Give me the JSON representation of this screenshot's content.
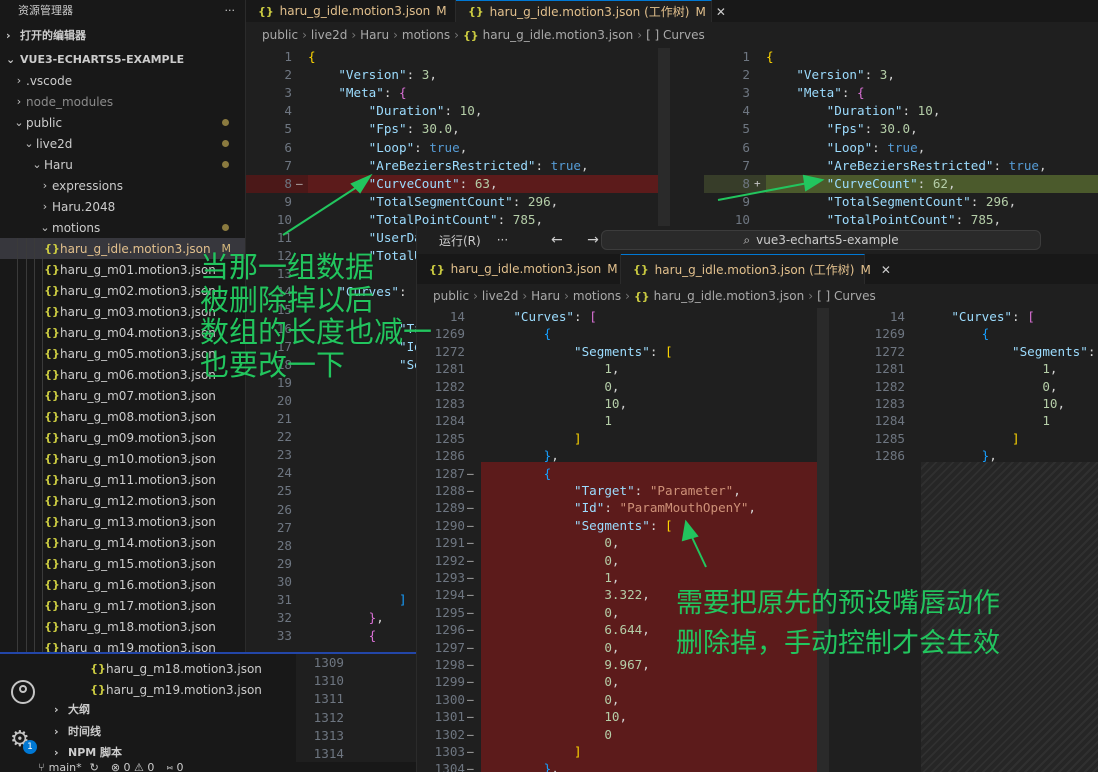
{
  "sidebar": {
    "header": "资源管理器",
    "header_dots": "···",
    "open_editors": "打开的编辑器",
    "project": "VUE3-ECHARTS5-EXAMPLE",
    "items": [
      {
        "label": ".vscode",
        "chev": "›"
      },
      {
        "label": "node_modules",
        "chev": "›"
      },
      {
        "label": "public",
        "chev": "⌄"
      },
      {
        "label": "live2d",
        "chev": "⌄"
      },
      {
        "label": "Haru",
        "chev": "⌄"
      },
      {
        "label": "expressions",
        "chev": "›"
      },
      {
        "label": "Haru.2048",
        "chev": "›"
      },
      {
        "label": "motions",
        "chev": "⌄"
      }
    ],
    "files": [
      "haru_g_idle.motion3.json",
      "haru_g_m01.motion3.json",
      "haru_g_m02.motion3.json",
      "haru_g_m03.motion3.json",
      "haru_g_m04.motion3.json",
      "haru_g_m05.motion3.json",
      "haru_g_m06.motion3.json",
      "haru_g_m07.motion3.json",
      "haru_g_m08.motion3.json",
      "haru_g_m09.motion3.json",
      "haru_g_m10.motion3.json",
      "haru_g_m11.motion3.json",
      "haru_g_m12.motion3.json",
      "haru_g_m13.motion3.json",
      "haru_g_m14.motion3.json",
      "haru_g_m15.motion3.json",
      "haru_g_m16.motion3.json",
      "haru_g_m17.motion3.json",
      "haru_g_m18.motion3.json",
      "haru_g_m19.motion3.json"
    ],
    "modified_flag": "M"
  },
  "editor1": {
    "tab1": "haru_g_idle.motion3.json",
    "tab2": "haru_g_idle.motion3.json (工作树)",
    "flag": "M",
    "close": "✕",
    "breadcrumb": [
      "public",
      "live2d",
      "Haru",
      "motions",
      "haru_g_idle.motion3.json",
      "[ ] Curves"
    ],
    "left_lines": [
      {
        "n": "1"
      },
      {
        "n": "2"
      },
      {
        "n": "3"
      },
      {
        "n": "4"
      },
      {
        "n": "5"
      },
      {
        "n": "6"
      },
      {
        "n": "7"
      },
      {
        "n": "8",
        "mark": "—"
      },
      {
        "n": "9"
      },
      {
        "n": "10"
      },
      {
        "n": "11"
      },
      {
        "n": "12"
      },
      {
        "n": "13"
      },
      {
        "n": "14"
      },
      {
        "n": "15"
      },
      {
        "n": "16"
      },
      {
        "n": "17"
      },
      {
        "n": "18"
      },
      {
        "n": "19"
      },
      {
        "n": "20"
      },
      {
        "n": "21"
      },
      {
        "n": "22"
      },
      {
        "n": "23"
      },
      {
        "n": "24"
      },
      {
        "n": "25"
      },
      {
        "n": "26"
      },
      {
        "n": "27"
      },
      {
        "n": "28"
      },
      {
        "n": "29"
      },
      {
        "n": "30"
      },
      {
        "n": "31"
      },
      {
        "n": "32"
      },
      {
        "n": "33"
      }
    ],
    "code": {
      "version_key": "\"Version\"",
      "version_val": "3",
      "meta_key": "\"Meta\"",
      "duration_key": "\"Duration\"",
      "duration_val": "10",
      "fps_key": "\"Fps\"",
      "fps_val": "30.0",
      "loop_key": "\"Loop\"",
      "loop_val": "true",
      "bez_key": "\"AreBeziersRestricted\"",
      "bez_val": "true",
      "curvecount_key": "\"CurveCount\"",
      "curvecount_old": "63",
      "curvecount_new": "62",
      "tseg_key": "\"TotalSegmentCount\"",
      "tseg_val": "296",
      "tpoint_key": "\"TotalPointCount\"",
      "tpoint_val": "785",
      "userdata_key": "\"UserDa",
      "totalu_key": "\"TotalU",
      "curves_key": "\"Curves\"",
      "ta_frag": "\"Ta",
      "id_frag": "\"Id",
      "se_frag": "\"Se"
    },
    "right_marker": "+"
  },
  "win2": {
    "menu_run": "运行(R)",
    "menu_dots": "···",
    "nav": "← →",
    "search": "vue3-echarts5-example",
    "tab1": "haru_g_idle.motion3.json",
    "tab2": "haru_g_idle.motion3.json (工作树)",
    "flag": "M",
    "close": "✕",
    "breadcrumb": [
      "public",
      "live2d",
      "Haru",
      "motions",
      "haru_g_idle.motion3.json",
      "[ ] Curves"
    ],
    "left_nums": [
      "14",
      "1269",
      "1272",
      "1281",
      "1282",
      "1283",
      "1284",
      "1285",
      "1286",
      "1287",
      "1288",
      "1289",
      "1290",
      "1291",
      "1292",
      "1293",
      "1294",
      "1295",
      "1296",
      "1297",
      "1298",
      "1299",
      "1300",
      "1301",
      "1302",
      "1303",
      "1304"
    ],
    "right_nums": [
      "14",
      "1269",
      "1272",
      "1281",
      "1282",
      "1283",
      "1284",
      "1285",
      "1286"
    ],
    "values": [
      "1",
      "0",
      "10",
      "1"
    ],
    "target_key": "\"Target\"",
    "target_val": "\"Parameter\"",
    "id_key": "\"Id\"",
    "id_val": "\"ParamMouthOpenY\"",
    "segments_key": "\"Segments\"",
    "seg_values": [
      "0",
      "0",
      "1",
      "3.322",
      "0",
      "6.644",
      "0",
      "9.967",
      "0",
      "0",
      "10",
      "0"
    ]
  },
  "lower": {
    "line_nums": [
      "1309",
      "1310",
      "1311",
      "1312",
      "1313",
      "1314"
    ],
    "files": [
      "haru_g_m18.motion3.json",
      "haru_g_m19.motion3.json"
    ],
    "sections": [
      "大纲",
      "时间线",
      "NPM 脚本"
    ],
    "badge": "1",
    "status_branch": "main*",
    "status_sync": "↻",
    "status_errors": "⊗ 0 ⚠ 0",
    "status_ports": "⑅ 0"
  },
  "annotations": {
    "a1": [
      "当那一组数据",
      "被删除掉以后",
      "数组的长度也减一",
      "也要改一下"
    ],
    "a2": [
      "需要把原先的预设嘴唇动作",
      "删除掉，手动控制才会生效"
    ]
  },
  "colors": {
    "annotation": "#22c55e",
    "deleted_bg": "#5c1b1b",
    "inserted_bg": "#4b5a2c",
    "accent": "#0078d4"
  }
}
